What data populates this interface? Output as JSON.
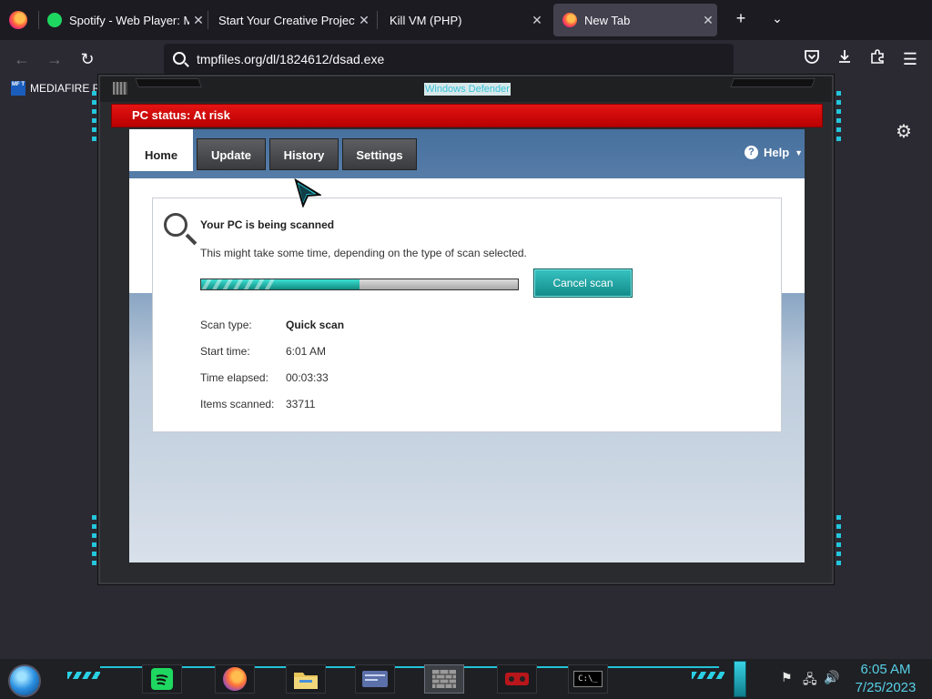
{
  "browser": {
    "tabs": [
      {
        "title": "Spotify - Web Player: Mu",
        "favicon": "spotify-icon",
        "color": "#1ed760"
      },
      {
        "title": "Start Your Creative Projects a",
        "favicon": "none"
      },
      {
        "title": "Kill VM (PHP)",
        "favicon": "none"
      },
      {
        "title": "New Tab",
        "favicon": "firefox-icon",
        "active": true
      }
    ],
    "url": "tmpfiles.org/dl/1824612/dsad.exe",
    "bookmark": {
      "label": "MEDIAFIRE R",
      "icon_text": "MF T"
    }
  },
  "window": {
    "title": "Windows Defender",
    "status": "PC status: At risk",
    "status_color": "#e41414",
    "tabs": [
      "Home",
      "Update",
      "History",
      "Settings"
    ],
    "active_tab": "Home",
    "help_label": "Help"
  },
  "scan": {
    "heading": "Your PC is being scanned",
    "description": "This might take some time, depending on the type of scan selected.",
    "progress": 0.5,
    "cancel_label": "Cancel scan",
    "details": [
      {
        "label": "Scan type:",
        "value": "Quick scan",
        "bold": true
      },
      {
        "label": "Start time:",
        "value": "6:01 AM"
      },
      {
        "label": "Time elapsed:",
        "value": "00:03:33"
      },
      {
        "label": "Items scanned:",
        "value": "33711"
      }
    ]
  },
  "taskbar": {
    "apps": [
      "spotify-icon",
      "firefox-icon",
      "file-explorer-icon",
      "id-card-icon",
      "wall-icon",
      "game-icon",
      "terminal-icon"
    ],
    "terminal_text": "C:\\_",
    "time": "6:05 AM",
    "date": "7/25/2023",
    "accent": "#22c4d8"
  }
}
